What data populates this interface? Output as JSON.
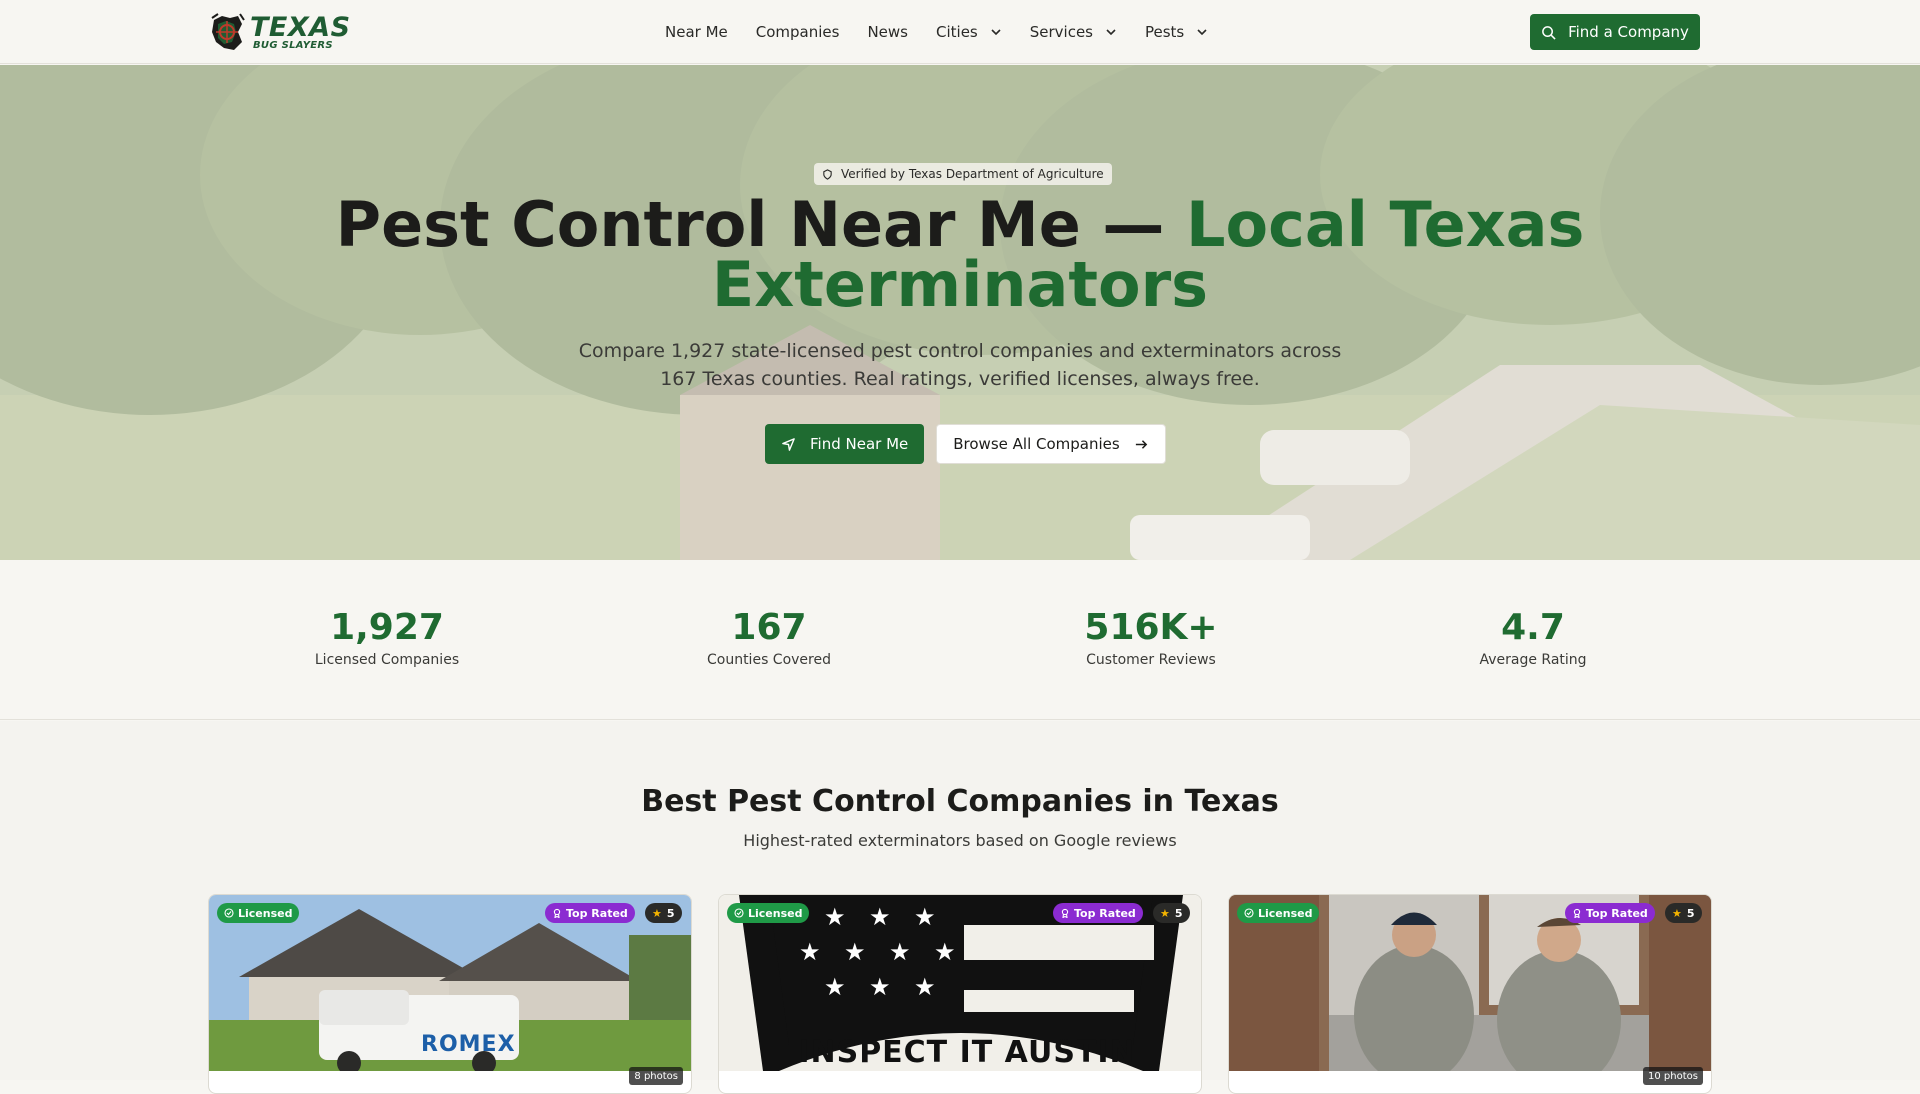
{
  "nav": {
    "logo_big": "TEXAS",
    "logo_small": "BUG SLAYERS",
    "links": [
      {
        "label": "Near Me",
        "dropdown": false
      },
      {
        "label": "Companies",
        "dropdown": false
      },
      {
        "label": "News",
        "dropdown": false
      },
      {
        "label": "Cities",
        "dropdown": true
      },
      {
        "label": "Services",
        "dropdown": true
      },
      {
        "label": "Pests",
        "dropdown": true
      }
    ],
    "cta_label": "Find a Company",
    "cta_icon": "search-icon"
  },
  "hero": {
    "verified_text": "Verified by Texas Department of Agriculture",
    "title_dark": "Pest Control Near Me — ",
    "title_green": "Local Texas Exterminators",
    "subtitle": "Compare 1,927 state-licensed pest control companies and exterminators across 167 Texas counties. Real ratings, verified licenses, always free.",
    "primary_button": "Find Near Me",
    "secondary_button": "Browse All Companies"
  },
  "stats": [
    {
      "value": "1,927",
      "label": "Licensed Companies"
    },
    {
      "value": "167",
      "label": "Counties Covered"
    },
    {
      "value": "516K+",
      "label": "Customer Reviews"
    },
    {
      "value": "4.7",
      "label": "Average Rating"
    }
  ],
  "best": {
    "title": "Best Pest Control Companies in Texas",
    "subtitle": "Highest-rated exterminators based on Google reviews",
    "cards": [
      {
        "licensed": "Licensed",
        "top": "Top Rated",
        "rating": "5",
        "photos": "8 photos",
        "image_text": "ROMEX"
      },
      {
        "licensed": "Licensed",
        "top": "Top Rated",
        "rating": "5",
        "photos": "",
        "image_text": "INSPECT IT AUSTIN"
      },
      {
        "licensed": "Licensed",
        "top": "Top Rated",
        "rating": "5",
        "photos": "10 photos",
        "image_text": ""
      }
    ]
  },
  "colors": {
    "brand_green": "#1f6b31",
    "licensed_badge": "#1f9a47",
    "top_rated_badge": "#8b2bd1",
    "background": "#f7f6f2"
  }
}
